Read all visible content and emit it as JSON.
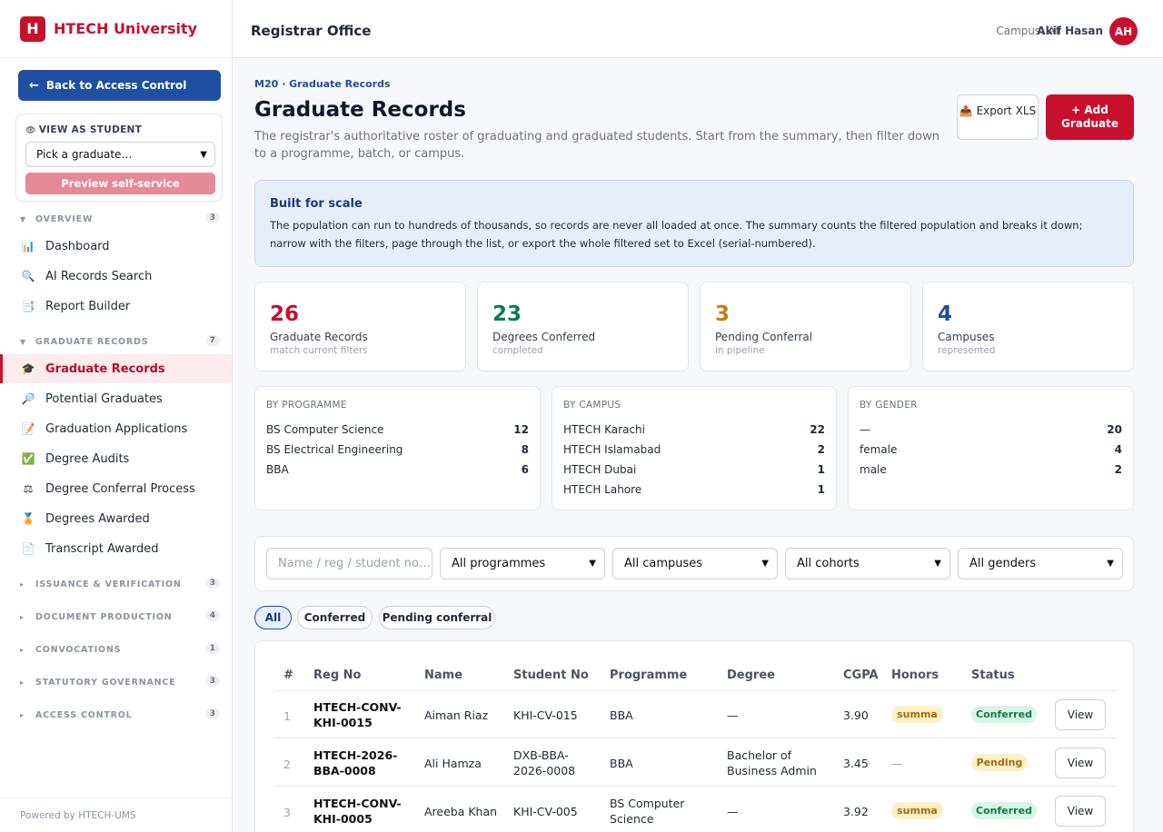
{
  "brand": {
    "logo": "H",
    "name": "HTECH University"
  },
  "sidebar": {
    "back_label": "Back to Access Control",
    "view_as": {
      "title": "VIEW AS STUDENT",
      "select_value": "Pick a graduate…",
      "preview_label": "Preview self-service"
    },
    "sections": {
      "overview": {
        "label": "OVERVIEW",
        "count": "3"
      },
      "graduate_records": {
        "label": "GRADUATE RECORDS",
        "count": "7"
      },
      "issuance": {
        "label": "ISSUANCE & VERIFICATION",
        "count": "3"
      },
      "document": {
        "label": "DOCUMENT PRODUCTION",
        "count": "4"
      },
      "convocations": {
        "label": "CONVOCATIONS",
        "count": "1"
      },
      "statutory": {
        "label": "STATUTORY GOVERNANCE",
        "count": "3"
      },
      "access": {
        "label": "ACCESS CONTROL",
        "count": "3"
      }
    },
    "items": {
      "dashboard": "Dashboard",
      "ai_search": "AI Records Search",
      "report_builder": "Report Builder",
      "graduate_records": "Graduate Records",
      "potential_graduates": "Potential Graduates",
      "graduation_applications": "Graduation Applications",
      "degree_audits": "Degree Audits",
      "degree_conferral": "Degree Conferral Process",
      "degrees_awarded": "Degrees Awarded",
      "transcript_awarded": "Transcript Awarded"
    },
    "footer": "Powered by HTECH-UMS"
  },
  "topbar": {
    "title": "Registrar Office",
    "campus": "Campus: All",
    "user": "Akif Hasan",
    "avatar": "AH"
  },
  "main": {
    "breadcrumb": "M20 · Graduate Records",
    "title": "Graduate Records",
    "description": "The registrar's authoritative roster of graduating and graduated students. Start from the summary, then filter down to a programme, batch, or campus.",
    "export_label": "Export XLS",
    "add_label": "+ Add Graduate",
    "notice": {
      "title": "Built for scale",
      "text": "The population can run to hundreds of thousands, so records are never all loaded at once. The summary counts the filtered population and breaks it down; narrow with the filters, page through the list, or export the whole filtered set to Excel (serial-numbered)."
    },
    "stats": [
      {
        "value": "26",
        "label": "Graduate Records",
        "sub": "match current filters",
        "color": "#c8102e"
      },
      {
        "value": "23",
        "label": "Degrees Conferred",
        "sub": "completed",
        "color": "#0f7a55"
      },
      {
        "value": "3",
        "label": "Pending Conferral",
        "sub": "in pipeline",
        "color": "#c77a0a"
      },
      {
        "value": "4",
        "label": "Campuses",
        "sub": "represented",
        "color": "#1e4fa3"
      }
    ],
    "by_programme": {
      "title": "BY PROGRAMME",
      "rows": [
        {
          "name": "BS Computer Science",
          "value": "12"
        },
        {
          "name": "BS Electrical Engineering",
          "value": "8"
        },
        {
          "name": "BBA",
          "value": "6"
        }
      ]
    },
    "by_campus": {
      "title": "BY CAMPUS",
      "rows": [
        {
          "name": "HTECH Karachi",
          "value": "22"
        },
        {
          "name": "HTECH Islamabad",
          "value": "2"
        },
        {
          "name": "HTECH Dubai",
          "value": "1"
        },
        {
          "name": "HTECH Lahore",
          "value": "1"
        }
      ]
    },
    "by_gender": {
      "title": "BY GENDER",
      "rows": [
        {
          "name": "—",
          "value": "20"
        },
        {
          "name": "female",
          "value": "4"
        },
        {
          "name": "male",
          "value": "2"
        }
      ]
    },
    "filters": {
      "search_placeholder": "Name / reg / student no…",
      "programme": "All programmes",
      "campus": "All campuses",
      "cohort": "All cohorts",
      "gender": "All genders"
    },
    "tabs": {
      "all": "All",
      "conferred": "Conferred",
      "pending": "Pending conferral"
    },
    "table": {
      "headers": {
        "idx": "#",
        "reg": "Reg No",
        "name": "Name",
        "student": "Student No",
        "programme": "Programme",
        "degree": "Degree",
        "cgpa": "CGPA",
        "honors": "Honors",
        "status": "Status"
      },
      "rows": [
        {
          "idx": "1",
          "reg": "HTECH-CONV-KHI-0015",
          "name": "Aiman Riaz",
          "student": "KHI-CV-015",
          "programme": "BBA",
          "degree": "—",
          "cgpa": "3.90",
          "honors": "summa",
          "status": "Conferred",
          "action": "View"
        },
        {
          "idx": "2",
          "reg": "HTECH-2026-BBA-0008",
          "name": "Ali Hamza",
          "student": "DXB-BBA-2026-0008",
          "programme": "BBA",
          "degree": "Bachelor of Business Admin",
          "cgpa": "3.45",
          "honors": "—",
          "status": "Pending",
          "action": "View"
        },
        {
          "idx": "3",
          "reg": "HTECH-CONV-KHI-0005",
          "name": "Areeba Khan",
          "student": "KHI-CV-005",
          "programme": "BS Computer Science",
          "degree": "—",
          "cgpa": "3.92",
          "honors": "summa",
          "status": "Conferred",
          "action": "View"
        }
      ]
    }
  }
}
